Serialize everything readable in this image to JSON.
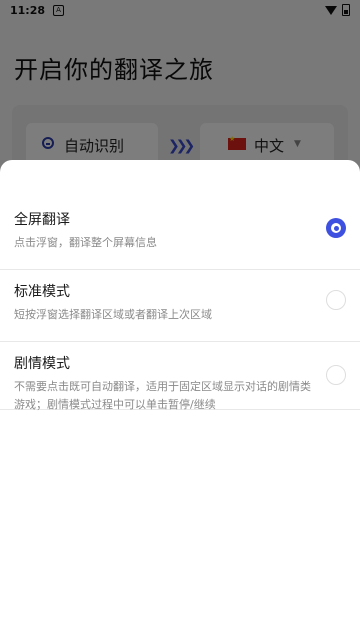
{
  "status_bar": {
    "time": "11:28",
    "notif_icon_letter": "A"
  },
  "background": {
    "title": "开启你的翻译之旅",
    "source_lang": "自动识别",
    "target_lang": "中文"
  },
  "sheet": {
    "options": [
      {
        "title": "全屏翻译",
        "desc": "点击浮窗，翻译整个屏幕信息",
        "selected": true
      },
      {
        "title": "标准模式",
        "desc": "短按浮窗选择翻译区域或者翻译上次区域",
        "selected": false
      },
      {
        "title": "剧情模式",
        "desc": "不需要点击既可自动翻译，适用于固定区域显示对话的剧情类游戏；剧情模式过程中可以单击暂停/继续",
        "selected": false
      }
    ]
  },
  "colors": {
    "accent": "#3d50e0"
  }
}
